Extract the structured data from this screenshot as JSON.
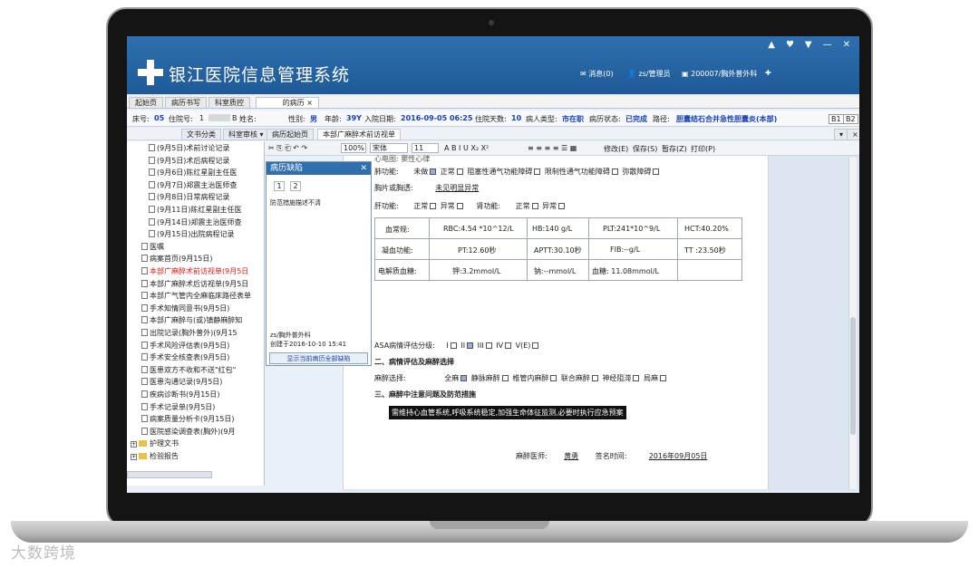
{
  "app": {
    "title": "银江医院信息管理系统",
    "header_messages": "消息(0)",
    "header_user": "zs/管理员",
    "header_dept": "200007/胸外普外科",
    "window_controls": [
      "▲",
      "♥",
      "▼",
      "—",
      "✕"
    ]
  },
  "tabs": [
    "起始页",
    "病历书写",
    "科室质控",
    "的病历 ×"
  ],
  "patient": {
    "bed_label": "床号:",
    "bed": "05",
    "inpatient_label": "住院号:",
    "inpatient_no": "1",
    "name_label": "姓名:",
    "name_suffix": "B",
    "sex_label": "性别:",
    "sex": "男",
    "age_label": "年龄:",
    "age": "39Y",
    "admit_label": "入院日期:",
    "admit_date": "2016-09-05 06:25",
    "days_label": "住院天数:",
    "days": "10",
    "type_label": "病人类型:",
    "type": "市在职",
    "status_label": "病历状态:",
    "status": "已完成",
    "path_label": "路径:",
    "path": "胆囊结石合并急性胆囊炎(本部)",
    "b1": "B1",
    "b2": "B2"
  },
  "subtabs": [
    "文书分类",
    "科室审核 ▾",
    "病历起始页",
    "本部广麻醉术前访视单"
  ],
  "toolbar": {
    "zoom": "100%",
    "font": "宋体",
    "size": "11",
    "format_icons": "A  B  I  U  X₂  X²",
    "modify": "修改(E)",
    "save": "保存(S)",
    "clear": "暂存(Z)",
    "print": "打印(P)"
  },
  "tree": {
    "items": [
      {
        "text": "(9月5日)术前讨论记录",
        "red": false
      },
      {
        "text": "(9月5日)术后病程记录",
        "red": false
      },
      {
        "text": "(9月6日)陈红星副主任医",
        "red": false
      },
      {
        "text": "(9月7日)郑震主治医师查",
        "red": false
      },
      {
        "text": "(9月8日)日常病程记录",
        "red": false
      },
      {
        "text": "(9月11日)陈红星副主任医",
        "red": false
      },
      {
        "text": "(9月14日)郑震主治医师查",
        "red": false
      },
      {
        "text": "(9月15日)出院病程记录",
        "red": false
      },
      {
        "text": "医嘱",
        "red": false
      },
      {
        "text": "病案首页(9月15日)",
        "red": false
      },
      {
        "text": "本部广麻醉术前访视单(9月5日",
        "red": true
      },
      {
        "text": "本部广麻醉术后访视单(9月5日",
        "red": false
      },
      {
        "text": "本部广气管内全麻临床路径表单",
        "red": false
      },
      {
        "text": "手术知情同意书(9月5日)",
        "red": false
      },
      {
        "text": "本部广麻醉与(或)镇静麻醉知",
        "red": false
      },
      {
        "text": "出院记录(胸外普外)(9月15",
        "red": false
      },
      {
        "text": "手术风险评估表(9月5日)",
        "red": false
      },
      {
        "text": "手术安全核查表(9月5日)",
        "red": false
      },
      {
        "text": "医患双方不收和不送\"红包\"",
        "red": false
      },
      {
        "text": "医患沟通记录(9月5日)",
        "red": false
      },
      {
        "text": "疾病诊断书(9月15日)",
        "red": false
      },
      {
        "text": "手术记录单(9月5日)",
        "red": false
      },
      {
        "text": "病案质量分析卡(9月15日)",
        "red": false
      },
      {
        "text": "医院感染调查表(胸外)(9月",
        "red": false
      }
    ],
    "folders": [
      "护理文书",
      "检验报告"
    ]
  },
  "popup": {
    "title": "病历缺陷",
    "pages": [
      "1",
      "2"
    ],
    "defect": "防范措施描述不清",
    "dept_user": "zs/胸外普外科",
    "created": "创建于2016-10-10 15:41",
    "button": "显示当前病历全部缺陷"
  },
  "doc": {
    "line0": "心电图:  窦性心律",
    "lung_label": "肺功能:",
    "lung_opts": [
      "未做",
      "正常",
      "阻塞性通气功能障碍",
      "限制性通气功能障碍",
      "弥散障碍"
    ],
    "chest_label": "胸片或胸透:",
    "chest_val": "未见明显异常",
    "liver_label": "肝功能:",
    "liver_opts": [
      "正常",
      "异常"
    ],
    "kidney_label": "肾功能:",
    "kidney_opts": [
      "正常",
      "异常"
    ],
    "lab": {
      "row1_label": "血常规:",
      "rbc": "RBC:4.54 *10^12/L",
      "hb": "HB:140 g/L",
      "plt": "PLT:241*10^9/L",
      "hct": "HCT:40.20%",
      "row2_label": "凝血功能:",
      "pt": "PT:12.60秒",
      "aptt": "APTT:30.10秒",
      "fib": "FIB:--g/L",
      "tt": "TT :23.50秒",
      "row3_label": "电解质血糖:",
      "k": "钾:3.2mmol/L",
      "na": "钠:--mmol/L",
      "glu": "血糖: 11.08mmol/L"
    },
    "asa_label": "ASA病情评估分级:",
    "asa_opts": [
      "I",
      "II",
      "III",
      "IV",
      "V(E)"
    ],
    "sec2": "二、病情评估及麻醉选择",
    "anes_label": "麻醉选择:",
    "anes_opts": [
      "全麻",
      "静脉麻醉",
      "椎管内麻醉",
      "联合麻醉",
      "神经阻滞",
      "局麻"
    ],
    "sec3": "三、麻醉中注意问题及防范措施",
    "note": "需维持心血管系统,呼吸系统稳定,加强生命体征监测,必要时执行应急预案",
    "sign_label": "麻醉医师:",
    "sign_name": "黄勇",
    "sign_time_label": "签名时间:",
    "sign_time": "2016年09月05日"
  },
  "watermark": "大数跨境"
}
